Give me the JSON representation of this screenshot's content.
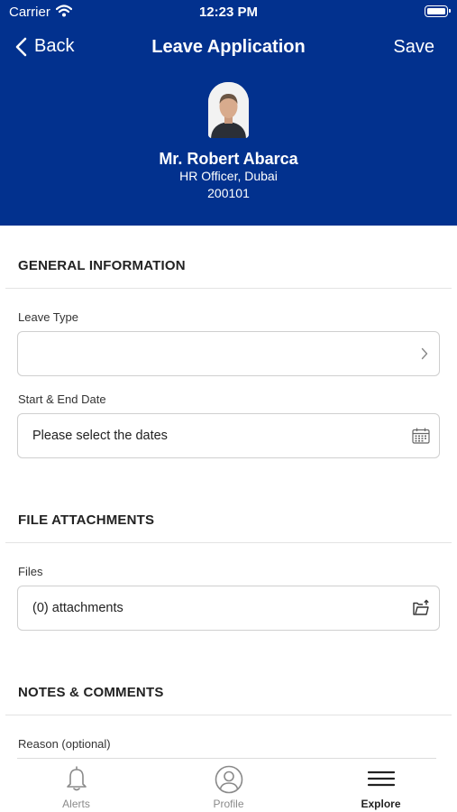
{
  "status_bar": {
    "carrier": "Carrier",
    "time": "12:23 PM"
  },
  "nav": {
    "back_label": "Back",
    "title": "Leave Application",
    "save_label": "Save"
  },
  "profile": {
    "name": "Mr. Robert Abarca",
    "role": "HR Officer, Dubai",
    "employee_id": "200101"
  },
  "sections": {
    "general": {
      "title": "GENERAL INFORMATION",
      "leave_type_label": "Leave Type",
      "leave_type_value": "",
      "dates_label": "Start & End Date",
      "dates_value": "Please select the dates"
    },
    "files": {
      "title": "FILE ATTACHMENTS",
      "files_label": "Files",
      "files_value": "(0) attachments"
    },
    "notes": {
      "title": "NOTES & COMMENTS",
      "reason_label": "Reason (optional)"
    }
  },
  "tabbar": {
    "items": [
      {
        "label": "Alerts",
        "icon": "bell-icon"
      },
      {
        "label": "Profile",
        "icon": "user-circle-icon"
      },
      {
        "label": "Explore",
        "icon": "menu-icon",
        "active": true
      }
    ]
  },
  "colors": {
    "header_bg": "#02318e",
    "text": "#222222",
    "tab_inactive": "#8a8a8a"
  }
}
